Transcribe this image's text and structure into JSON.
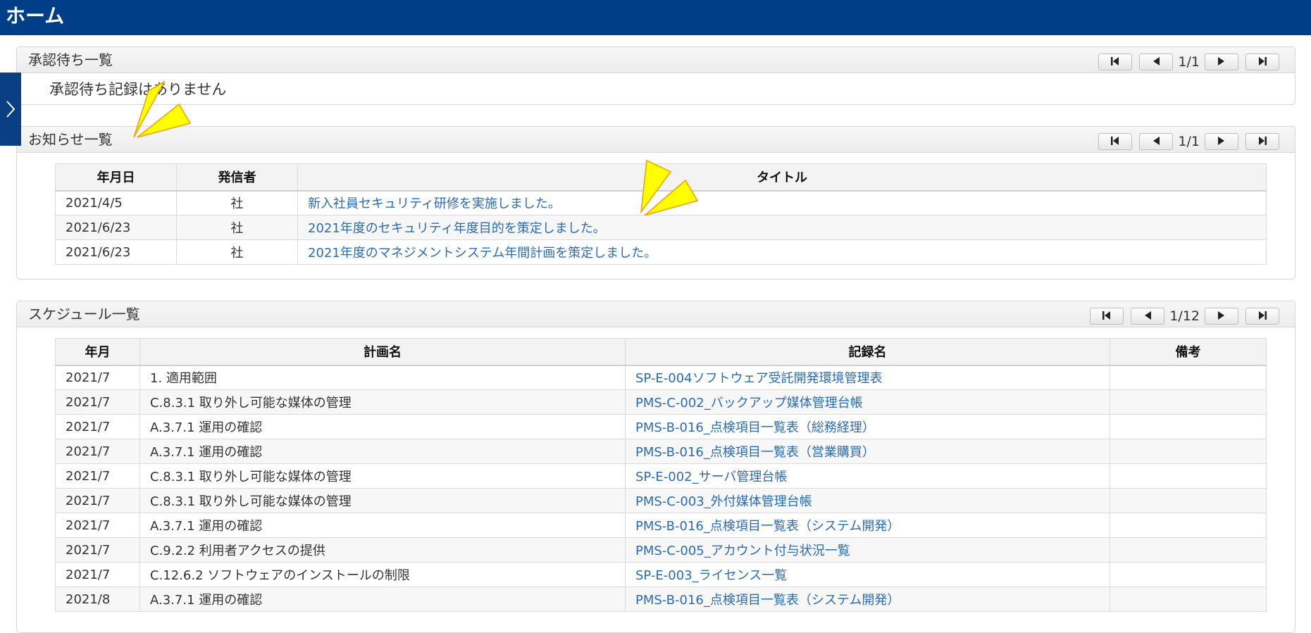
{
  "header": {
    "title": "ホーム"
  },
  "approvals": {
    "title": "承認待ち一覧",
    "page": "1/1",
    "empty_message": "承認待ち記録はありません"
  },
  "notices": {
    "title": "お知らせ一覧",
    "page": "1/1",
    "columns": [
      "年月日",
      "発信者",
      "タイトル"
    ],
    "rows": [
      {
        "date": "2021/4/5",
        "sender": "社",
        "title": "新入社員セキュリティ研修を実施しました。"
      },
      {
        "date": "2021/6/23",
        "sender": "社",
        "title": "2021年度のセキュリティ年度目的を策定しました。"
      },
      {
        "date": "2021/6/23",
        "sender": "社",
        "title": "2021年度のマネジメントシステム年間計画を策定しました。"
      }
    ]
  },
  "schedule": {
    "title": "スケジュール一覧",
    "page": "1/12",
    "columns": [
      "年月",
      "計画名",
      "記録名",
      "備考"
    ],
    "rows": [
      {
        "month": "2021/7",
        "plan": "1. 適用範囲",
        "record": "SP-E-004ソフトウェア受託開発環境管理表",
        "note": ""
      },
      {
        "month": "2021/7",
        "plan": "C.8.3.1 取り外し可能な媒体の管理",
        "record": "PMS-C-002_バックアップ媒体管理台帳",
        "note": ""
      },
      {
        "month": "2021/7",
        "plan": "A.3.7.1 運用の確認",
        "record": "PMS-B-016_点検項目一覧表（総務経理）",
        "note": ""
      },
      {
        "month": "2021/7",
        "plan": "A.3.7.1 運用の確認",
        "record": "PMS-B-016_点検項目一覧表（営業購買）",
        "note": ""
      },
      {
        "month": "2021/7",
        "plan": "C.8.3.1 取り外し可能な媒体の管理",
        "record": "SP-E-002_サーバ管理台帳",
        "note": ""
      },
      {
        "month": "2021/7",
        "plan": "C.8.3.1 取り外し可能な媒体の管理",
        "record": "PMS-C-003_外付媒体管理台帳",
        "note": ""
      },
      {
        "month": "2021/7",
        "plan": "A.3.7.1 運用の確認",
        "record": "PMS-B-016_点検項目一覧表（システム開発）",
        "note": ""
      },
      {
        "month": "2021/7",
        "plan": "C.9.2.2 利用者アクセスの提供",
        "record": "PMS-C-005_アカウント付与状況一覧",
        "note": ""
      },
      {
        "month": "2021/7",
        "plan": "C.12.6.2 ソフトウェアのインストールの制限",
        "record": "SP-E-003_ライセンス一覧",
        "note": ""
      },
      {
        "month": "2021/8",
        "plan": "A.3.7.1 運用の確認",
        "record": "PMS-B-016_点検項目一覧表（システム開発）",
        "note": ""
      }
    ]
  },
  "colors": {
    "header": "#003f87",
    "link": "#2a6bb5",
    "spark_fill": "#ffff00",
    "spark_stroke": "#f0a000"
  }
}
